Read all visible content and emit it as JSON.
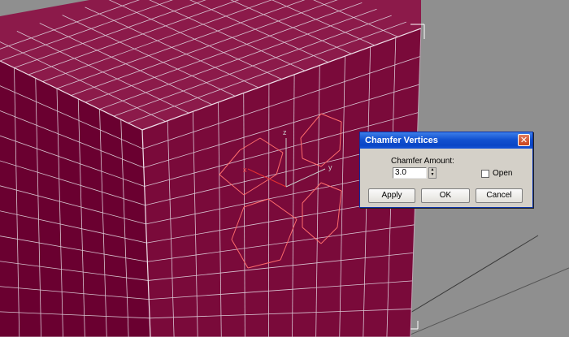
{
  "viewport": {
    "axis_labels": {
      "x": "x",
      "y": "y",
      "z": "z"
    },
    "colors": {
      "background": "#8f8f8f",
      "front_face": "#6a0030",
      "right_face": "#7a0a3a",
      "top_face": "#8c1a4a",
      "wire": "#d9c4d2",
      "selection": "#ff6c6c",
      "bracket": "#ffffff"
    }
  },
  "dialog": {
    "title": "Chamfer Vertices",
    "close_glyph": "✕",
    "amount_label": "Chamfer Amount:",
    "amount_value": "3.0",
    "open_label": "Open",
    "open_checked": false,
    "apply_label": "Apply",
    "ok_label": "OK",
    "cancel_label": "Cancel",
    "spinner_up": "▲",
    "spinner_down": "▼"
  }
}
